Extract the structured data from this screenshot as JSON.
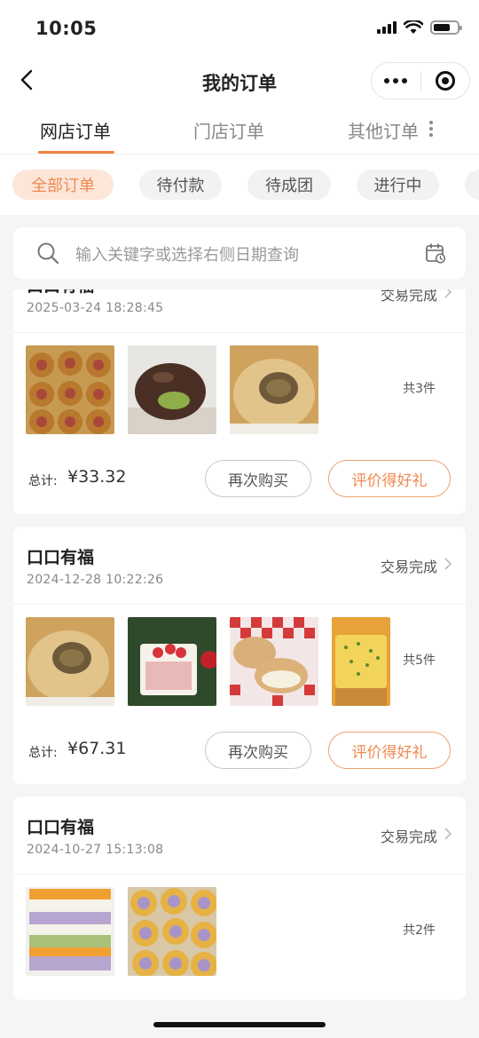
{
  "status_bar": {
    "time": "10:05"
  },
  "nav": {
    "title": "我的订单"
  },
  "main_tabs": [
    {
      "label": "网店订单",
      "active": true
    },
    {
      "label": "门店订单",
      "active": false
    },
    {
      "label": "其他订单",
      "active": false
    }
  ],
  "filters": [
    {
      "label": "全部订单",
      "active": true
    },
    {
      "label": "待付款",
      "active": false
    },
    {
      "label": "待成团",
      "active": false
    },
    {
      "label": "进行中",
      "active": false
    }
  ],
  "search": {
    "placeholder": "输入关键字或选择右侧日期查询"
  },
  "labels": {
    "total": "总计:",
    "rebuy": "再次购买",
    "review": "评价得好礼"
  },
  "orders": [
    {
      "shop": "口口有福",
      "time": "2025-03-24 18:28:45",
      "status": "交易完成",
      "count": "共3件",
      "total": "¥33.32",
      "products": [
        "sausage-bread-image",
        "chocolate-donut-image",
        "meat-floss-bun-image"
      ]
    },
    {
      "shop": "口口有福",
      "time": "2024-12-28 10:22:26",
      "status": "交易完成",
      "count": "共5件",
      "total": "¥67.31",
      "products": [
        "meat-floss-bun-image",
        "strawberry-cake-image",
        "cream-bun-image",
        "cheese-toast-image"
      ]
    },
    {
      "shop": "口口有福",
      "time": "2024-10-27 15:13:08",
      "status": "交易完成",
      "count": "共2件",
      "total": "",
      "products": [
        "layer-cake-image",
        "taro-roll-image"
      ]
    }
  ]
}
